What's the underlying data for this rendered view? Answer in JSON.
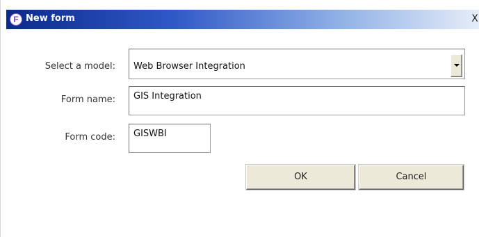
{
  "window": {
    "title": "New form",
    "app_icon_letter": "F",
    "close_glyph": "X"
  },
  "form": {
    "model_label": "Select a model:",
    "model_value": "Web Browser Integration",
    "name_label": "Form name:",
    "name_value": "GIS Integration",
    "code_label": "Form code:",
    "code_value": "GISWBI"
  },
  "buttons": {
    "ok_label": "OK",
    "cancel_label": "Cancel"
  },
  "colors": {
    "titlebar_start": "#0b2a8a",
    "titlebar_end": "#e6edf8",
    "button_face": "#ece9d8"
  },
  "icons": {
    "app": "form-app-icon",
    "close": "close-icon",
    "dropdown": "chevron-down-icon"
  }
}
